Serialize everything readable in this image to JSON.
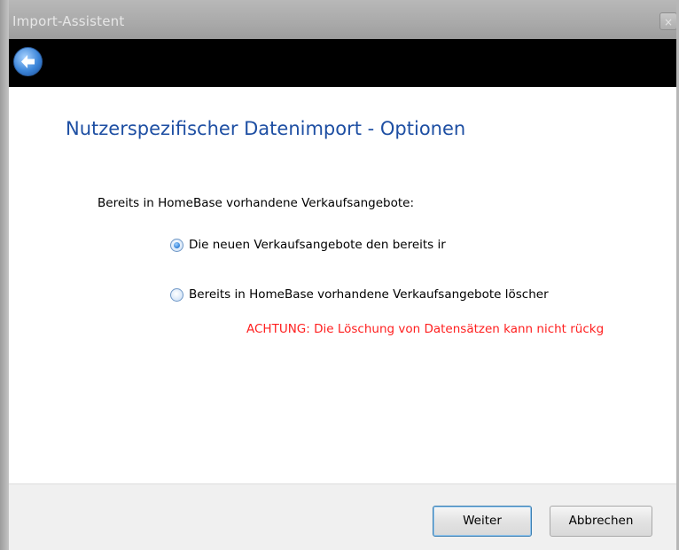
{
  "window": {
    "title": "Import-Assistent",
    "close_label": "×"
  },
  "nav": {
    "back_icon": "arrow-left-icon"
  },
  "main": {
    "heading": "Nutzerspezifischer Datenimport - Optionen",
    "section_label": "Bereits in HomeBase vorhandene Verkaufsangebote:",
    "options": [
      {
        "label": "Die neuen Verkaufsangebote den bereits ir",
        "checked": true
      },
      {
        "label": "Bereits in HomeBase vorhandene Verkaufsangebote löscher",
        "checked": false
      }
    ],
    "warning": "ACHTUNG: Die Löschung von Datensätzen kann nicht rückg"
  },
  "footer": {
    "next_label": "Weiter",
    "cancel_label": "Abbrechen"
  },
  "colors": {
    "heading": "#1e4fa3",
    "warning": "#ff1f1f",
    "nav_bar": "#000000"
  }
}
